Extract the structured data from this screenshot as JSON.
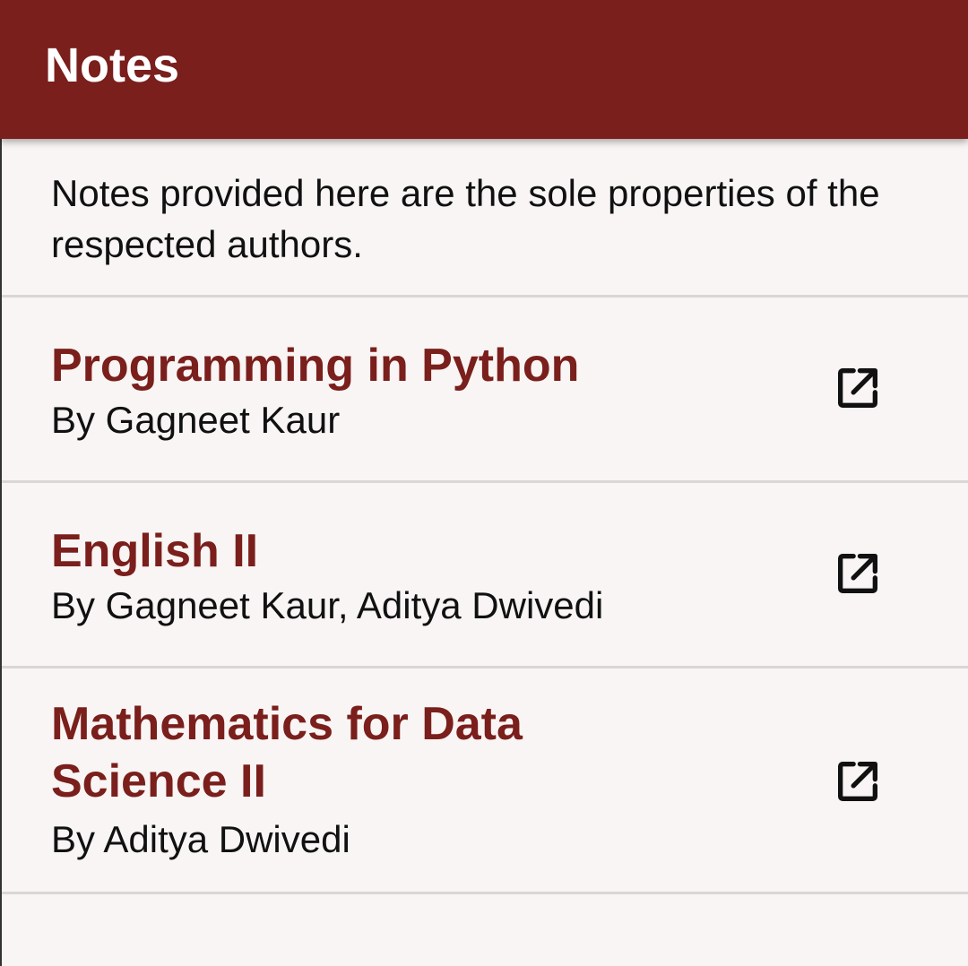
{
  "app_bar": {
    "title": "Notes",
    "background_color": "#7a1f1c"
  },
  "disclaimer": "Notes provided here are the sole properties of the respected authors.",
  "notes": [
    {
      "title": "Programming in Python",
      "authors": "By Gagneet Kaur",
      "icon": "open-in-new-icon"
    },
    {
      "title": "English II",
      "authors": "By Gagneet Kaur, Aditya Dwivedi",
      "icon": "open-in-new-icon"
    },
    {
      "title": "Mathematics for Data Science II",
      "authors": "By Aditya Dwivedi",
      "icon": "open-in-new-icon"
    }
  ],
  "colors": {
    "accent": "#7a1f1c",
    "background": "#f8f5f4",
    "divider": "#d9d6d5"
  }
}
